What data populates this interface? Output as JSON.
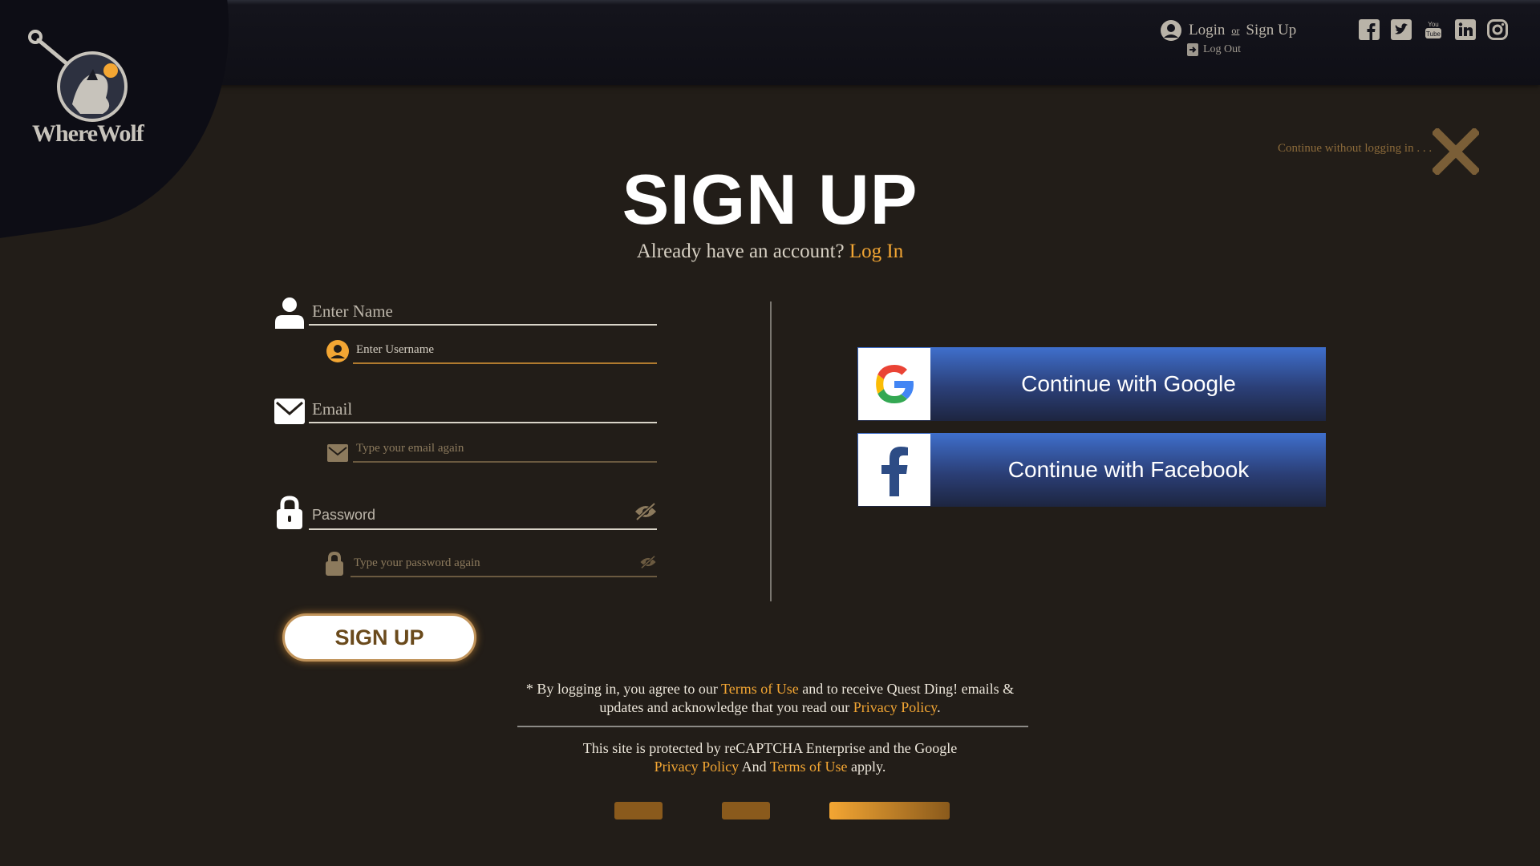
{
  "brand": {
    "name": "WhereWolf"
  },
  "header": {
    "login": "Login",
    "or": "or",
    "signup": "Sign Up",
    "logout": "Log Out",
    "social_icons": [
      "facebook-icon",
      "twitter-icon",
      "youtube-icon",
      "linkedin-icon",
      "instagram-icon"
    ]
  },
  "skip_text": "Continue without logging in . . .",
  "title": "SIGN UP",
  "subtitle": {
    "prefix": "Already have an account?",
    "link": "Log In"
  },
  "form": {
    "name_placeholder": "Enter Name",
    "username_placeholder": "Enter Username",
    "email_placeholder": "Email",
    "email_confirm_placeholder": "Type your email again",
    "password_placeholder": "Password",
    "password_confirm_placeholder": "Type your password again",
    "submit_label": "SIGN UP"
  },
  "sso": {
    "google_label": "Continue with Google",
    "facebook_label": "Continue with Facebook"
  },
  "terms": {
    "t1": "* By logging in, you agree to our ",
    "link1": "Terms of Use",
    "t2": " and to receive Quest Ding! emails &",
    "t3": "updates and acknowledge that you read our ",
    "link2": "Privacy Policy",
    "t4": "."
  },
  "recaptcha": {
    "t1": "This site is protected by reCAPTCHA Enterprise and the Google",
    "link1": "Privacy Policy",
    "t2": " And ",
    "link2": "Terms of Use",
    "t3": " apply."
  },
  "colors": {
    "accent": "#f3a633",
    "background": "#221d18",
    "sso_blue": "#3f6fcc"
  },
  "progress": {
    "steps": 3,
    "active_step": 3
  }
}
